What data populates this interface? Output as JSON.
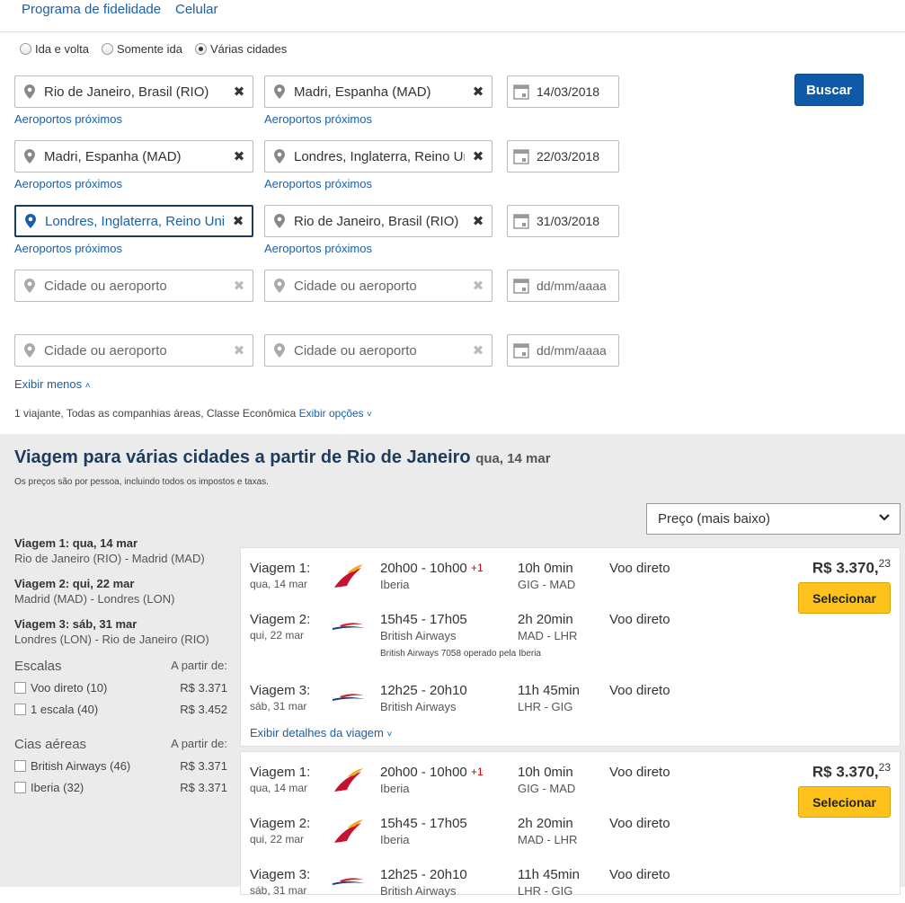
{
  "topnav": {
    "loyalty": "Programa de fidelidade",
    "mobile": "Celular"
  },
  "trip_type": {
    "round_trip": "Ida e volta",
    "one_way": "Somente ida",
    "multi_city": "Várias cidades",
    "selected": "multi_city"
  },
  "legs": [
    {
      "from": "Rio de Janeiro, Brasil (RIO)",
      "to": "Madri, Espanha (MAD)",
      "date": "14/03/2018",
      "near_from": "Aeroportos próximos",
      "near_to": "Aeroportos próximos"
    },
    {
      "from": "Madri, Espanha (MAD)",
      "to": "Londres, Inglaterra, Reino Unido",
      "date": "22/03/2018",
      "near_from": "Aeroportos próximos",
      "near_to": "Aeroportos próximos"
    },
    {
      "from": "Londres, Inglaterra, Reino Unido",
      "to": "Rio de Janeiro, Brasil (RIO)",
      "date": "31/03/2018",
      "near_from": "Aeroportos próximos",
      "near_to": "Aeroportos próximos"
    },
    {
      "from_placeholder": "Cidade ou aeroporto",
      "to_placeholder": "Cidade ou aeroporto",
      "date_placeholder": "dd/mm/aaaa"
    },
    {
      "from_placeholder": "Cidade ou aeroporto",
      "to_placeholder": "Cidade ou aeroporto",
      "date_placeholder": "dd/mm/aaaa"
    }
  ],
  "search_button": "Buscar",
  "show_less": "Exibir menos",
  "options_summary": "1 viajante, Todas as companhias áreas, Classe Econômica",
  "show_options": "Exibir opções",
  "results": {
    "title": "Viagem para várias cidades a partir de Rio de Janeiro",
    "title_date": "qua, 14 mar",
    "note": "Os preços são por pessoa, incluindo todos os impostos e taxas.",
    "sort": "Preço (mais baixo)"
  },
  "sidebar": {
    "trips": [
      {
        "title": "Viagem 1: qua, 14 mar",
        "route": "Rio de Janeiro (RIO) - Madrid (MAD)"
      },
      {
        "title": "Viagem 2: qui, 22 mar",
        "route": "Madrid (MAD) - Londres (LON)"
      },
      {
        "title": "Viagem 3: sáb, 31 mar",
        "route": "Londres (LON) - Rio de Janeiro (RIO)"
      }
    ],
    "stops_header": "Escalas",
    "from_label": "A partir de:",
    "stops": [
      {
        "label": "Voo direto (10)",
        "price": "R$ 3.371"
      },
      {
        "label": "1 escala (40)",
        "price": "R$ 3.452"
      }
    ],
    "airlines_header": "Cias aéreas",
    "airlines": [
      {
        "label": "British Airways (46)",
        "price": "R$ 3.371"
      },
      {
        "label": "Iberia (32)",
        "price": "R$ 3.371"
      }
    ]
  },
  "cards": [
    {
      "price_main": "R$ 3.370,",
      "price_cents": "23",
      "select": "Selecionar",
      "details": "Exibir detalhes da viagem",
      "operated_note": "British Airways 7058 operado pela Iberia",
      "legs": [
        {
          "label": "Viagem 1:",
          "date": "qua, 14 mar",
          "airline": "Iberia",
          "times": "20h00 - 10h00",
          "plus": "+1",
          "duration": "10h 0min",
          "route": "GIG - MAD",
          "stops": "Voo direto",
          "logo": "iberia"
        },
        {
          "label": "Viagem 2:",
          "date": "qui, 22 mar",
          "airline": "British Airways",
          "times": "15h45 - 17h05",
          "plus": "",
          "duration": "2h 20min",
          "route": "MAD - LHR",
          "stops": "Voo direto",
          "logo": "ba"
        },
        {
          "label": "Viagem 3:",
          "date": "sáb, 31 mar",
          "airline": "British Airways",
          "times": "12h25 - 20h10",
          "plus": "",
          "duration": "11h 45min",
          "route": "LHR - GIG",
          "stops": "Voo direto",
          "logo": "ba"
        }
      ]
    },
    {
      "price_main": "R$ 3.370,",
      "price_cents": "23",
      "select": "Selecionar",
      "legs": [
        {
          "label": "Viagem 1:",
          "date": "qua, 14 mar",
          "airline": "Iberia",
          "times": "20h00 - 10h00",
          "plus": "+1",
          "duration": "10h 0min",
          "route": "GIG - MAD",
          "stops": "Voo direto",
          "logo": "iberia"
        },
        {
          "label": "Viagem 2:",
          "date": "qui, 22 mar",
          "airline": "Iberia",
          "times": "15h45 - 17h05",
          "plus": "",
          "duration": "2h 20min",
          "route": "MAD - LHR",
          "stops": "Voo direto",
          "logo": "iberia"
        },
        {
          "label": "Viagem 3:",
          "date": "sáb, 31 mar",
          "airline": "British Airways",
          "times": "12h25 - 20h10",
          "plus": "",
          "duration": "11h 45min",
          "route": "LHR - GIG",
          "stops": "Voo direto",
          "logo": "ba"
        }
      ]
    }
  ]
}
